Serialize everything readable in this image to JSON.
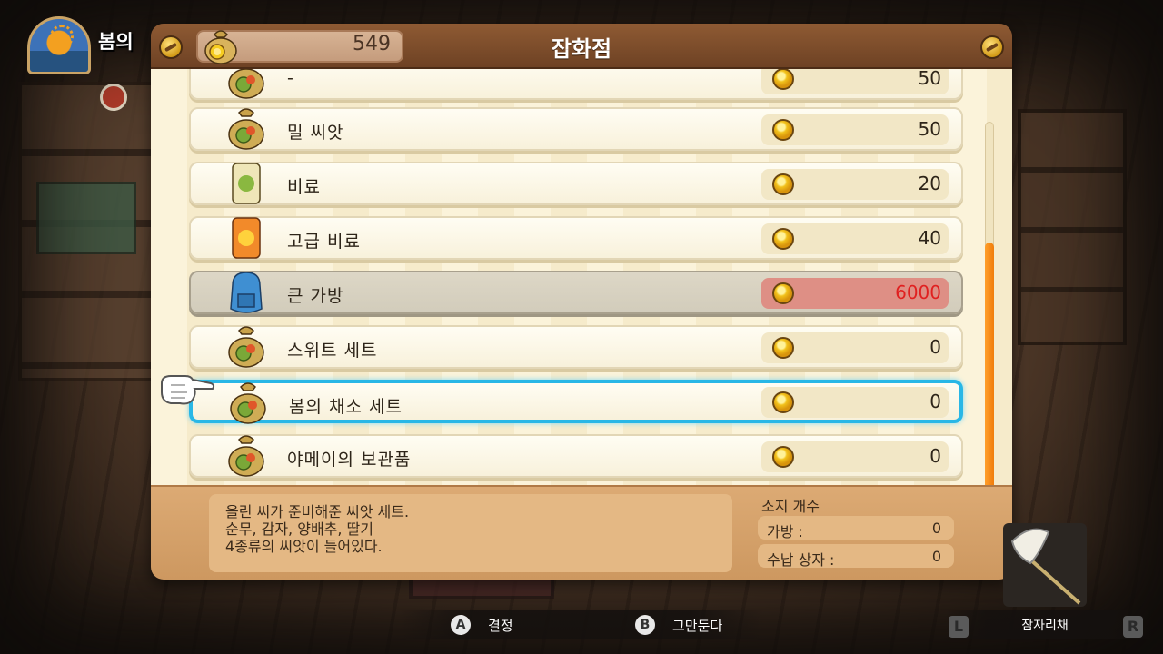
{
  "hud": {
    "season_label": "봄의"
  },
  "shop": {
    "title": "잡화점",
    "money": "549",
    "items": [
      {
        "name": "-",
        "price": "50",
        "icon": "seed-bag-icon"
      },
      {
        "name": "밀 씨앗",
        "price": "50",
        "icon": "seed-bag-icon"
      },
      {
        "name": "비료",
        "price": "20",
        "icon": "fertilizer-icon"
      },
      {
        "name": "고급 비료",
        "price": "40",
        "icon": "premium-fertilizer-icon"
      },
      {
        "name": "큰 가방",
        "price": "6000",
        "icon": "backpack-icon",
        "state": "unaffordable"
      },
      {
        "name": "스위트 세트",
        "price": "0",
        "icon": "seed-bag-icon"
      },
      {
        "name": "봄의 채소 세트",
        "price": "0",
        "icon": "seed-bag-icon",
        "state": "focused"
      },
      {
        "name": "야메이의 보관품",
        "price": "0",
        "icon": "seed-bag-icon"
      }
    ],
    "description": [
      "올린 씨가 준비해준 씨앗 세트.",
      "순무, 감자, 양배추, 딸기",
      "4종류의 씨앗이 들어있다."
    ],
    "owned": {
      "title": "소지 개수",
      "bag_label": "가방 :",
      "bag_value": "0",
      "storage_label": "수납 상자 :",
      "storage_value": "0"
    },
    "scroll_fraction_start": 0.3,
    "scroll_fraction_end": 1.0
  },
  "controls": {
    "a_button": "A",
    "a_label": "결정",
    "b_button": "B",
    "b_label": "그만둔다",
    "l_button": "L",
    "r_button": "R",
    "tool_label": "잠자리채"
  },
  "colors": {
    "focus_outline": "#29b7e6",
    "unaffordable_price": "#e02020",
    "scroll_thumb": "#f07d0c"
  }
}
